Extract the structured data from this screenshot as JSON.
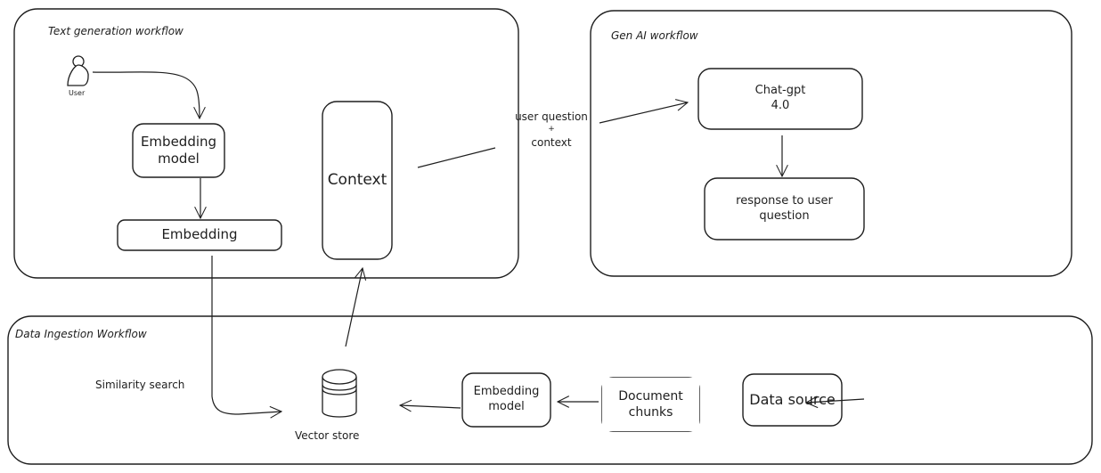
{
  "frames": {
    "text_generation": {
      "title": "Text generation workflow"
    },
    "gen_ai": {
      "title": "Gen AI workflow"
    },
    "data_ingestion": {
      "title": "Data Ingestion Workflow"
    }
  },
  "nodes": {
    "user": {
      "label": "User",
      "icon": "user-icon"
    },
    "embedding_model_top": {
      "line1": "Embedding",
      "line2": "model"
    },
    "embedding": {
      "label": "Embedding"
    },
    "context": {
      "label": "Context"
    },
    "chat_gpt": {
      "line1": "Chat-gpt",
      "line2": "4.0"
    },
    "response": {
      "line1": "response to user",
      "line2": "question"
    },
    "vector_store": {
      "label": "Vector store",
      "icon": "database-icon"
    },
    "embedding_model_bottom": {
      "line1": "Embedding",
      "line2": "model"
    },
    "document_chunks": {
      "line1": "Document",
      "line2": "chunks"
    },
    "data_source": {
      "label": "Data source"
    }
  },
  "edges": {
    "context_to_chatgpt": {
      "line1": "user question",
      "line2": "+",
      "line3": "context"
    },
    "similarity_search": {
      "label": "Similarity search"
    }
  }
}
